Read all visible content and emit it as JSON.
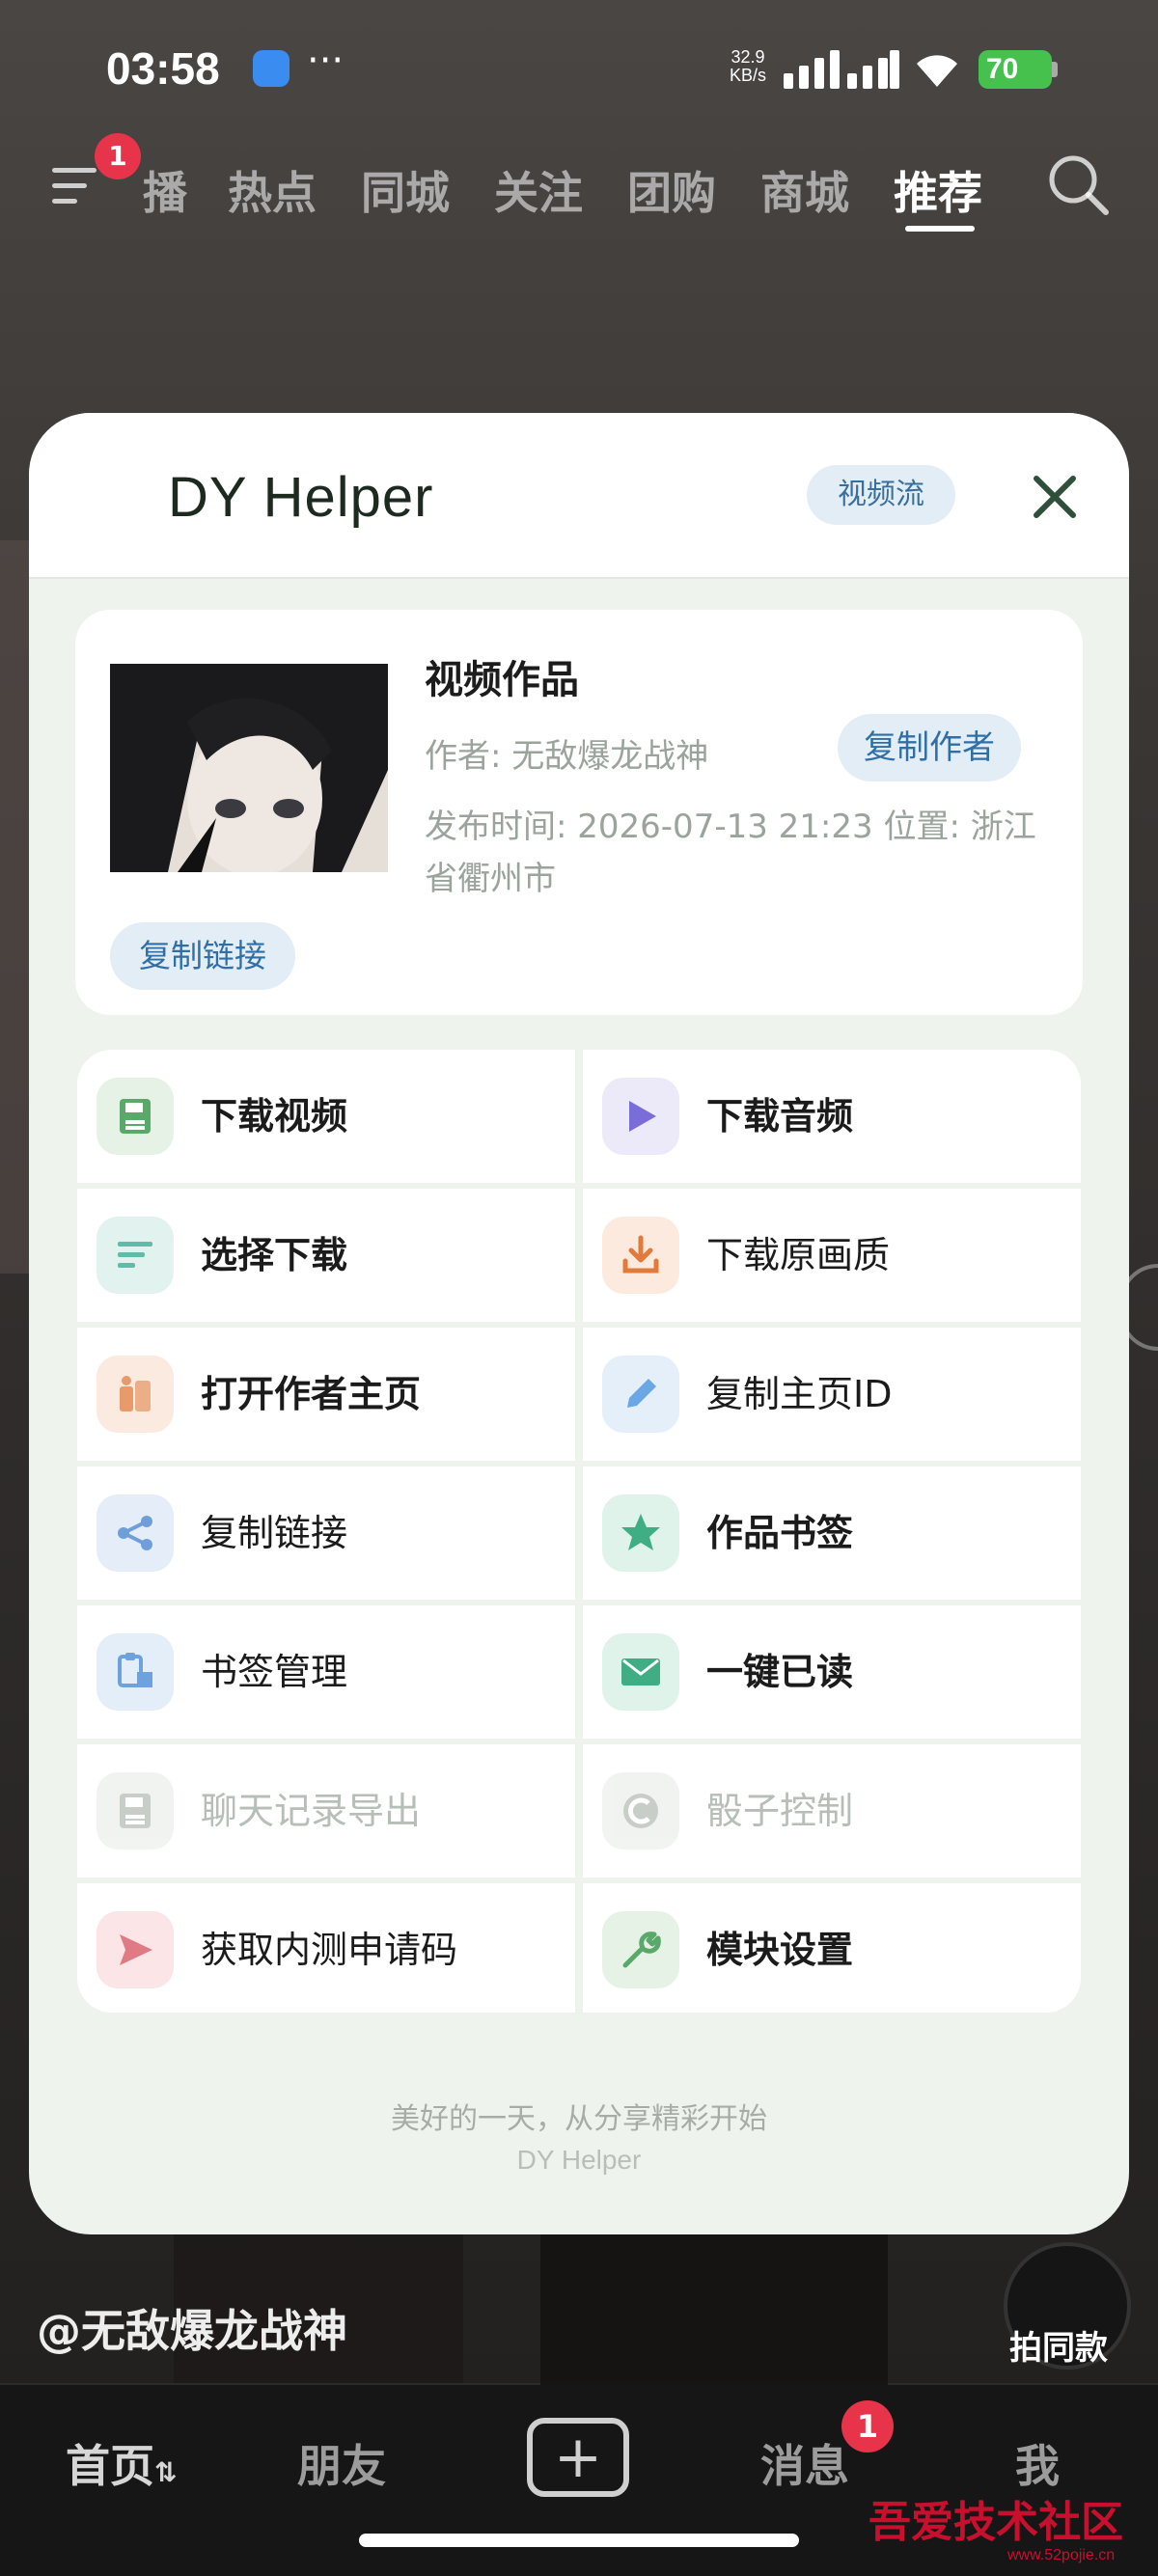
{
  "status_bar": {
    "time": "03:58",
    "more": "···",
    "speed_value": "32.9",
    "speed_unit": "KB/s",
    "battery": "70"
  },
  "top_nav": {
    "menu_badge": "1",
    "tabs": [
      "播",
      "热点",
      "同城",
      "关注",
      "团购",
      "商城",
      "推荐"
    ],
    "active_tab": "推荐"
  },
  "modal": {
    "title": "DY Helper",
    "mode_chip": "视频流",
    "info": {
      "title": "视频作品",
      "author": "作者: 无敌爆龙战神",
      "copy_author": "复制作者",
      "meta": "发布时间: 2026-07-13 21:23  位置: 浙江省衢州市",
      "copy_link": "复制链接"
    },
    "actions": [
      {
        "label": "下载视频",
        "icon": "save-icon",
        "color": "#5aa86a",
        "bg": "#e6f2e6",
        "disabled": false,
        "bold": true
      },
      {
        "label": "下载音频",
        "icon": "play-icon",
        "color": "#7a6cd9",
        "bg": "#ece9f8",
        "disabled": false,
        "bold": true
      },
      {
        "label": "选择下载",
        "icon": "list-icon",
        "color": "#5fbca8",
        "bg": "#e2f3ef",
        "disabled": false,
        "bold": true
      },
      {
        "label": "下载原画质",
        "icon": "download-icon",
        "color": "#e07b3c",
        "bg": "#fbeadd",
        "disabled": false,
        "bold": false
      },
      {
        "label": "打开作者主页",
        "icon": "person-icon",
        "color": "#e79a6a",
        "bg": "#fbeadf",
        "disabled": false,
        "bold": true
      },
      {
        "label": "复制主页ID",
        "icon": "pencil-icon",
        "color": "#6aa7e4",
        "bg": "#e4eff9",
        "disabled": false,
        "bold": false
      },
      {
        "label": "复制链接",
        "icon": "share-icon",
        "color": "#6f9ed9",
        "bg": "#e4edf8",
        "disabled": false,
        "bold": false
      },
      {
        "label": "作品书签",
        "icon": "star-icon",
        "color": "#3fae85",
        "bg": "#e0f3ea",
        "disabled": false,
        "bold": true
      },
      {
        "label": "书签管理",
        "icon": "clipboard-icon",
        "color": "#6ea2dc",
        "bg": "#e4eef8",
        "disabled": false,
        "bold": false
      },
      {
        "label": "一键已读",
        "icon": "mail-icon",
        "color": "#3fae85",
        "bg": "#e0f3ea",
        "disabled": false,
        "bold": true
      },
      {
        "label": "聊天记录导出",
        "icon": "save-icon",
        "color": "#9aa59b",
        "bg": "#e6ebe6",
        "disabled": true,
        "bold": false
      },
      {
        "label": "骰子控制",
        "icon": "dice-icon",
        "color": "#9aa59b",
        "bg": "#e6ebe6",
        "disabled": true,
        "bold": false
      },
      {
        "label": "获取内测申请码",
        "icon": "send-icon",
        "color": "#e07b85",
        "bg": "#fbe5e7",
        "disabled": false,
        "bold": false
      },
      {
        "label": "模块设置",
        "icon": "wrench-icon",
        "color": "#5aa86a",
        "bg": "#e6f2e6",
        "disabled": false,
        "bold": true
      }
    ],
    "footer_line1": "美好的一天，从分享精彩开始",
    "footer_line2": "DY Helper"
  },
  "overlay": {
    "author": "@无敌爆龙战神",
    "same_style": "拍同款"
  },
  "tab_bar": {
    "home": "首页",
    "home_arrow": "⇅",
    "friends": "朋友",
    "plus": "+",
    "messages": "消息",
    "messages_badge": "1",
    "me": "我"
  },
  "watermark": {
    "text": "吾爱技术社区",
    "url": "www.52pojie.cn"
  }
}
